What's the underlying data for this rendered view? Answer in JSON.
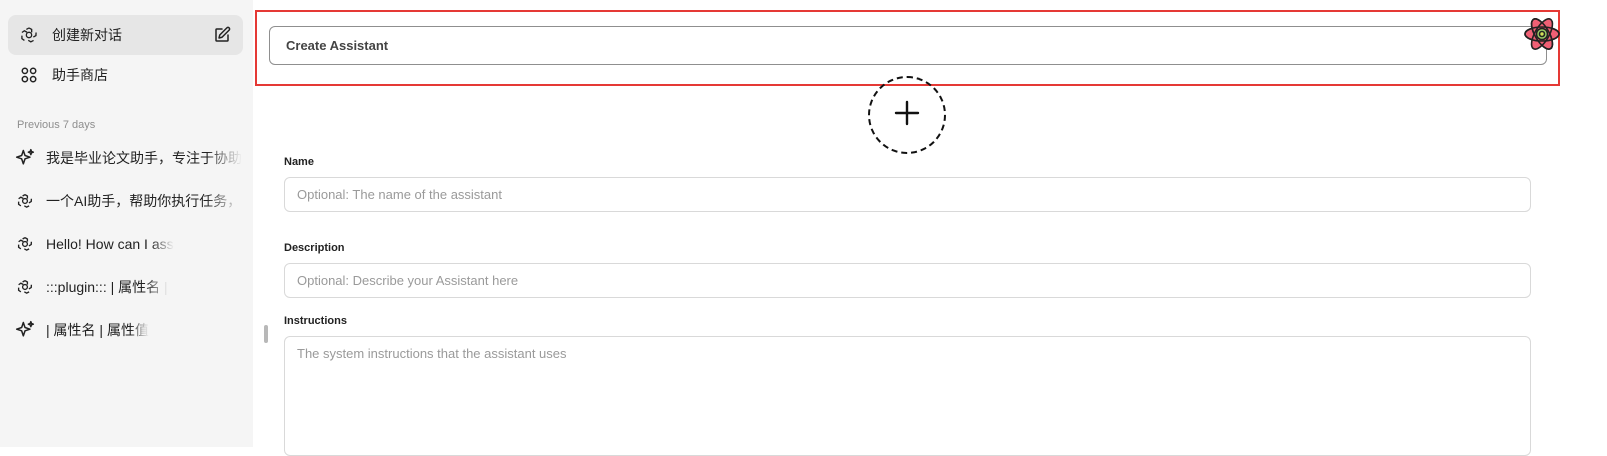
{
  "sidebar": {
    "new_chat_label": "创建新对话",
    "store_label": "助手商店",
    "section_title": "Previous 7 days",
    "chats": [
      {
        "icon": "sparkle-icon",
        "label": "我是毕业论文助手，专注于协助"
      },
      {
        "icon": "openai-icon",
        "label": "一个AI助手，帮助你执行任务，"
      },
      {
        "icon": "openai-icon",
        "label": "Hello! How can I ass"
      },
      {
        "icon": "openai-icon",
        "label": ":::plugin::: | 属性名 |"
      },
      {
        "icon": "sparkle-icon",
        "label": "| 属性名 | 属性值"
      }
    ]
  },
  "main": {
    "assistant_select_value": "Create Assistant",
    "name": {
      "label": "Name",
      "placeholder": "Optional: The name of the assistant"
    },
    "description": {
      "label": "Description",
      "placeholder": "Optional: Describe your Assistant here"
    },
    "instructions": {
      "label": "Instructions",
      "placeholder": "The system instructions that the assistant uses"
    }
  },
  "colors": {
    "highlight": "#e53935",
    "sidebar_bg": "#f5f5f5",
    "active_item": "#e6e6e6"
  }
}
